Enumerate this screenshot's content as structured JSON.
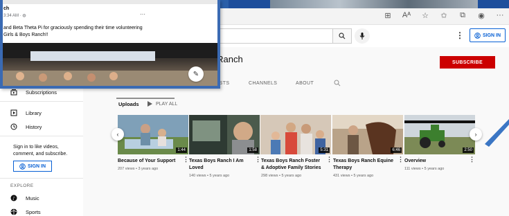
{
  "fb_post": {
    "name": "ch",
    "time": "3:34 AM · ",
    "dots": "···",
    "text_line1": "and Beta Theta Pi for graciously spending their time volunteering",
    "text_line2": "Girls & Boys Ranch!!"
  },
  "header": {
    "menu_dots": "⋮",
    "signin_label": "SIGN IN"
  },
  "chrome_icons": [
    "grid-icon",
    "reader-icon",
    "favorite-add-icon",
    "favorites-icon",
    "collections-icon",
    "profile-icon",
    "more-icon"
  ],
  "channel": {
    "name": "s Ranch",
    "subscribe_label": "SUBSCRIBE",
    "tabs": [
      "LISTS",
      "CHANNELS",
      "ABOUT"
    ]
  },
  "sidebar": {
    "items": [
      {
        "label": "Subscriptions",
        "icon": "subscriptions-icon"
      },
      {
        "label": "Library",
        "icon": "library-icon"
      },
      {
        "label": "History",
        "icon": "history-icon"
      }
    ],
    "signin_note": "Sign in to like videos, comment, and subscribe.",
    "signin_label": "SIGN IN",
    "explore_label": "EXPLORE",
    "explore_items": [
      {
        "label": "Music",
        "icon": "music-icon"
      },
      {
        "label": "Sports",
        "icon": "sports-icon"
      }
    ]
  },
  "uploads": {
    "label": "Uploads",
    "play_all": "PLAY ALL",
    "videos": [
      {
        "title": "Because of Your Support",
        "meta": "207 views • 3 years ago",
        "duration": "1:44"
      },
      {
        "title": "Texas Boys Ranch I Am Loved",
        "meta": "140 views • 5 years ago",
        "duration": "1:58"
      },
      {
        "title": "Texas Boys Ranch Foster & Adoptive Family Stories",
        "meta": "298 views • 5 years ago",
        "duration": "5:31"
      },
      {
        "title": "Texas Boys Ranch Equine Therapy",
        "meta": "431 views • 5 years ago",
        "duration": "6:46"
      },
      {
        "title": "Overview",
        "meta": "111 views • 5 years ago",
        "duration": "2:50"
      }
    ]
  }
}
